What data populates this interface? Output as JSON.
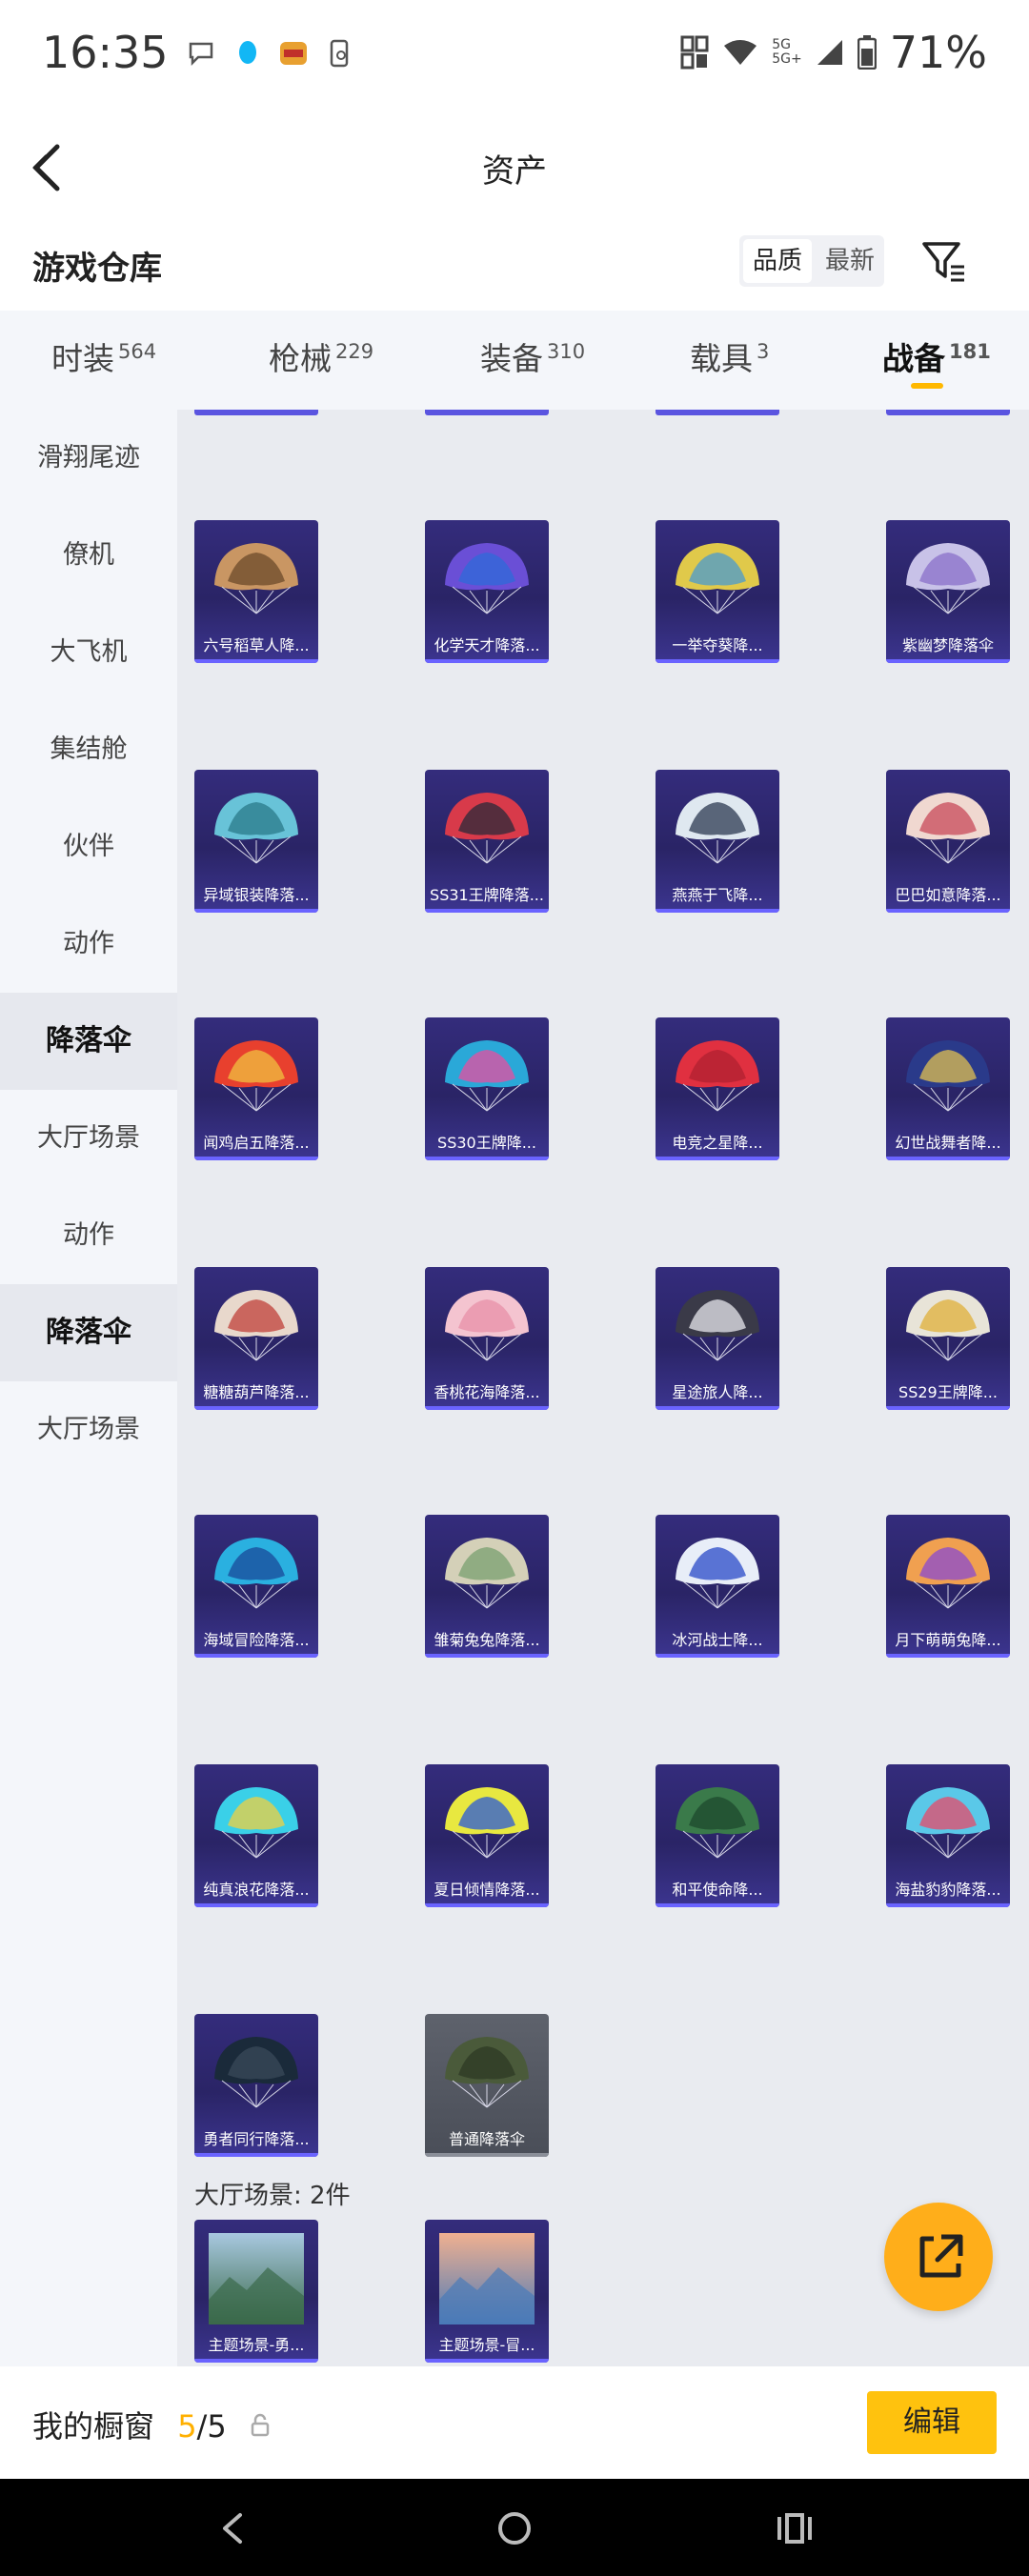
{
  "status_bar": {
    "time": "16:35",
    "battery": "71%",
    "signal_top": "5G",
    "signal_bottom": "5G+",
    "left_icons": [
      "chat-bubble-icon",
      "qq-icon",
      "app-badge-icon",
      "phone-sync-icon"
    ],
    "right_icons": [
      "nfc-icon",
      "wifi-icon",
      "signal-icon",
      "battery-icon"
    ]
  },
  "header": {
    "title": "资产",
    "back_icon": "back-arrow-icon"
  },
  "toolbar": {
    "section_title": "游戏仓库",
    "sort_options": [
      "品质",
      "最新"
    ],
    "active_sort": "品质",
    "filter_icon": "filter-icon"
  },
  "tabs": [
    {
      "label": "时装",
      "count": "564"
    },
    {
      "label": "枪械",
      "count": "229"
    },
    {
      "label": "装备",
      "count": "310"
    },
    {
      "label": "载具",
      "count": "3"
    },
    {
      "label": "战备",
      "count": "181",
      "active": true
    }
  ],
  "sidebar": {
    "items": [
      {
        "label": "滑翔尾迹"
      },
      {
        "label": "僚机"
      },
      {
        "label": "大飞机"
      },
      {
        "label": "集结舱"
      },
      {
        "label": "伙伴"
      },
      {
        "label": "动作"
      },
      {
        "label": "降落伞",
        "active": true
      },
      {
        "label": "大厅场景"
      },
      {
        "label": "动作"
      },
      {
        "label": "降落伞",
        "active": true
      },
      {
        "label": "大厅场景"
      }
    ]
  },
  "parachutes": [
    {
      "name": "六号稻草人降...",
      "canopy": [
        "#c99663",
        "#6b4a2a"
      ]
    },
    {
      "name": "化学天才降落...",
      "canopy": [
        "#6a4fd6",
        "#2f6ad8"
      ]
    },
    {
      "name": "一举夺葵降...",
      "canopy": [
        "#e0c94a",
        "#4a9ad0"
      ]
    },
    {
      "name": "紫幽梦降落伞",
      "canopy": [
        "#c8c2e8",
        "#8a6fc9"
      ]
    },
    {
      "name": "异域银装降落...",
      "canopy": [
        "#68c3d8",
        "#2a7a8a"
      ]
    },
    {
      "name": "SS31王牌降落...",
      "canopy": [
        "#d83a4a",
        "#2a2a3a"
      ]
    },
    {
      "name": "燕燕于飞降...",
      "canopy": [
        "#dfe8f0",
        "#2c3a52"
      ]
    },
    {
      "name": "巴巴如意降落...",
      "canopy": [
        "#f0d8d0",
        "#c84a5a"
      ]
    },
    {
      "name": "闻鸡启五降落...",
      "canopy": [
        "#e8402e",
        "#f0c040"
      ]
    },
    {
      "name": "SS30王牌降...",
      "canopy": [
        "#2aa8d8",
        "#e84ea0"
      ]
    },
    {
      "name": "电竞之星降...",
      "canopy": [
        "#e03040",
        "#b02030"
      ]
    },
    {
      "name": "幻世战舞者降...",
      "canopy": [
        "#2a3a8a",
        "#e0c050"
      ]
    },
    {
      "name": "糖糖葫芦降落...",
      "canopy": [
        "#e8d8cc",
        "#c0403a"
      ]
    },
    {
      "name": "香桃花海降落...",
      "canopy": [
        "#f4c4d0",
        "#e890a8"
      ]
    },
    {
      "name": "星途旅人降...",
      "canopy": [
        "#3a3a48",
        "#e8e8ee"
      ]
    },
    {
      "name": "SS29王牌降...",
      "canopy": [
        "#e8e4d8",
        "#e0b03a"
      ]
    },
    {
      "name": "海域冒险降落...",
      "canopy": [
        "#2ab0e0",
        "#1a4a9a"
      ]
    },
    {
      "name": "雏菊兔兔降落...",
      "canopy": [
        "#d4d0b8",
        "#7aa070"
      ]
    },
    {
      "name": "冰河战士降...",
      "canopy": [
        "#e8eef8",
        "#2a4ac8"
      ]
    },
    {
      "name": "月下萌萌兔降...",
      "canopy": [
        "#f0a050",
        "#8a4ad0"
      ]
    },
    {
      "name": "纯真浪花降落...",
      "canopy": [
        "#3ad0e8",
        "#f0d040"
      ]
    },
    {
      "name": "夏日倾情降落...",
      "canopy": [
        "#e8e840",
        "#2a5ad8"
      ]
    },
    {
      "name": "和平使命降...",
      "canopy": [
        "#3a7a4a",
        "#1e4a2e"
      ]
    },
    {
      "name": "海盐豹豹降落...",
      "canopy": [
        "#5ac8e8",
        "#e84a6a"
      ]
    },
    {
      "name": "勇者同行降落...",
      "canopy": [
        "#1a2a3a",
        "#3a4a5a"
      ]
    },
    {
      "name": "普通降落伞",
      "canopy": [
        "#4a5a3a",
        "#2e3a24"
      ],
      "style": "grey"
    }
  ],
  "lobby_section": {
    "label": "大厅场景: 2件",
    "items": [
      {
        "name": "主题场景-勇...",
        "sky": [
          "#a8c8e0",
          "#3a6a4a"
        ]
      },
      {
        "name": "主题场景-冒...",
        "sky": [
          "#f0b090",
          "#4a7ab8"
        ]
      }
    ]
  },
  "fab": {
    "icon": "share-external-icon"
  },
  "footer": {
    "label": "我的橱窗",
    "count_current": "5",
    "count_sep": "/",
    "count_total": "5",
    "lock_icon": "lock-icon",
    "edit_label": "编辑"
  },
  "navbar": {
    "icons": [
      "nav-back-icon",
      "nav-home-icon",
      "nav-recents-icon"
    ]
  },
  "colors": {
    "accent": "#ffb800",
    "card_bg": "#2a2466",
    "grid_bg": "#e9ebf0",
    "sidebar_bg": "#f4f6fa"
  }
}
